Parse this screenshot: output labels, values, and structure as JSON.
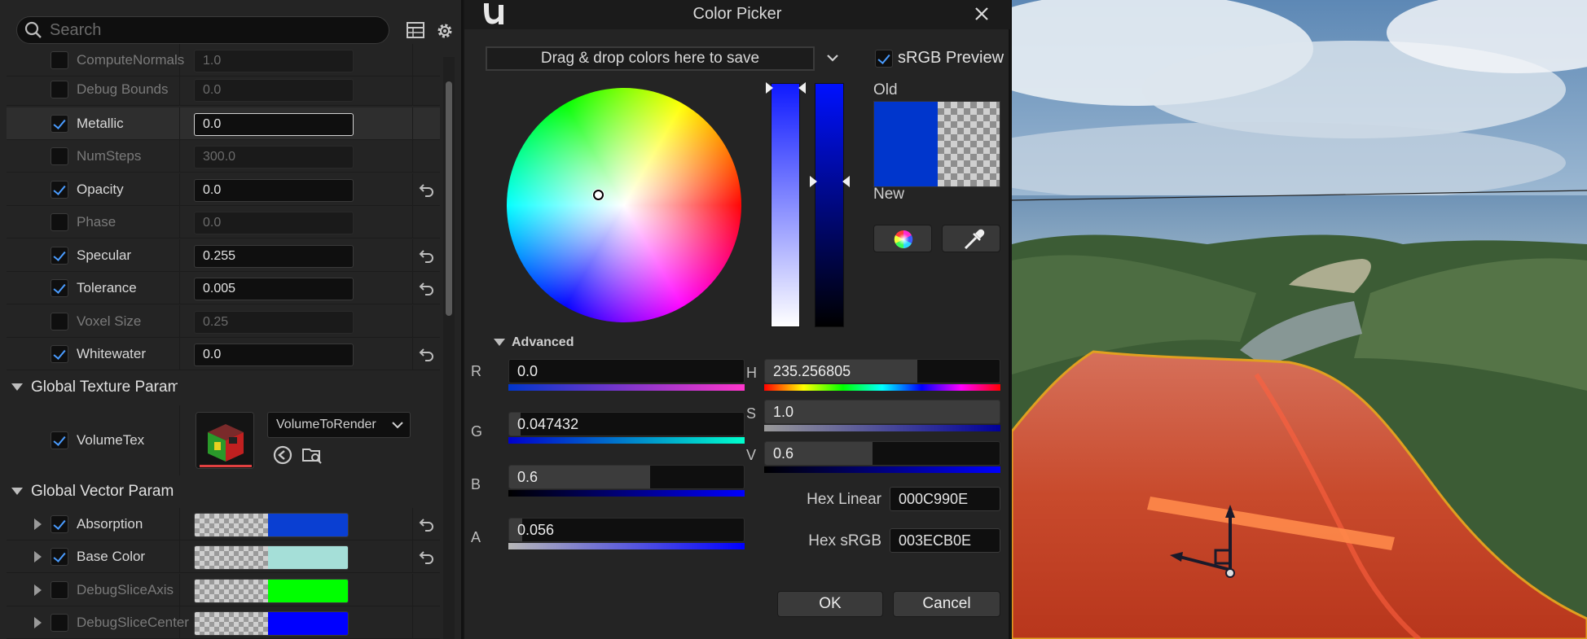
{
  "details": {
    "search_placeholder": "Search",
    "params": [
      {
        "name": "ComputeNormals",
        "value": "1.0",
        "checked": false
      },
      {
        "name": "Debug Bounds",
        "value": "0.0",
        "checked": false
      },
      {
        "name": "Metallic",
        "value": "0.0",
        "checked": true
      },
      {
        "name": "NumSteps",
        "value": "300.0",
        "checked": false
      },
      {
        "name": "Opacity",
        "value": "0.0",
        "checked": true
      },
      {
        "name": "Phase",
        "value": "0.0",
        "checked": false
      },
      {
        "name": "Specular",
        "value": "0.255",
        "checked": true
      },
      {
        "name": "Tolerance",
        "value": "0.005",
        "checked": true
      },
      {
        "name": "Voxel Size",
        "value": "0.25",
        "checked": false
      },
      {
        "name": "Whitewater",
        "value": "0.0",
        "checked": true
      }
    ],
    "texture_category": "Global Texture Param",
    "texture_param": {
      "name": "VolumeTex",
      "dropdown": "VolumeToRender",
      "checked": true
    },
    "vector_category": "Global Vector Param",
    "vector_params": [
      {
        "name": "Absorption",
        "checked": true,
        "color": "#0a3fd2"
      },
      {
        "name": "Base Color",
        "checked": true,
        "color": "#a5dfd8"
      },
      {
        "name": "DebugSliceAxis",
        "checked": false,
        "color": "#00ff00"
      },
      {
        "name": "DebugSliceCenter",
        "checked": false,
        "color": "#0000ff"
      }
    ]
  },
  "picker": {
    "title": "Color Picker",
    "drag_save": "Drag & drop colors here to save",
    "srgb_preview": "sRGB Preview",
    "old_label": "Old",
    "new_label": "New",
    "advanced": "Advanced",
    "channels": {
      "R": {
        "label": "R",
        "value": "0.0"
      },
      "G": {
        "label": "G",
        "value": "0.047432"
      },
      "B": {
        "label": "B",
        "value": "0.6"
      },
      "A": {
        "label": "A",
        "value": "0.056"
      },
      "H": {
        "label": "H",
        "value": "235.256805"
      },
      "S": {
        "label": "S",
        "value": "1.0"
      },
      "V": {
        "label": "V",
        "value": "0.6"
      }
    },
    "hex_linear_label": "Hex Linear",
    "hex_linear": "000C990E",
    "hex_srgb_label": "Hex sRGB",
    "hex_srgb": "003ECB0E",
    "ok": "OK",
    "cancel": "Cancel",
    "preview_color": "#0036cc"
  }
}
